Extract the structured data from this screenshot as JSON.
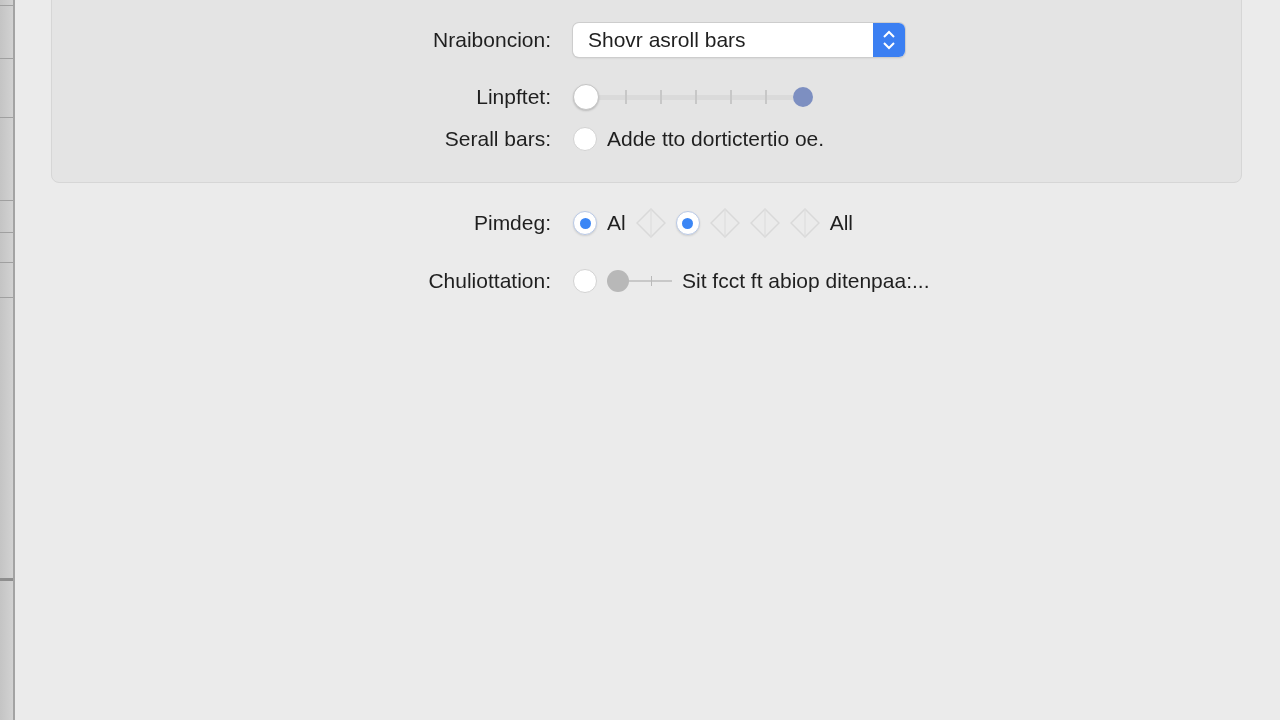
{
  "panel": {
    "rows": [
      {
        "label": "Nraiboncion:",
        "controls": [
          {
            "kind": "popup",
            "value": "Shovr asroll bars"
          }
        ]
      },
      {
        "label": "Linpftet:",
        "controls": [
          {
            "kind": "tick_slider",
            "level": 0
          },
          {
            "kind": "dot"
          }
        ]
      },
      {
        "label": "Serall bars:",
        "controls": [
          {
            "kind": "radio",
            "selected": false
          },
          {
            "kind": "text",
            "text": "Adde tto dortictertio oe."
          }
        ]
      }
    ]
  },
  "rows": [
    {
      "label": "Pimdeg:",
      "controls": [
        {
          "kind": "radio",
          "selected": true
        },
        {
          "kind": "text",
          "text": "Al"
        },
        {
          "kind": "icon"
        },
        {
          "kind": "radio",
          "selected": true
        },
        {
          "kind": "icon"
        },
        {
          "kind": "icon"
        },
        {
          "kind": "icon"
        },
        {
          "kind": "text",
          "text": "All"
        }
      ]
    },
    {
      "label": "Chuliottation:",
      "controls": [
        {
          "kind": "radio",
          "selected": false
        },
        {
          "kind": "small_slider",
          "level": 0
        },
        {
          "kind": "text",
          "text": "Sit fcct ft abiop ditenpaa:..."
        }
      ]
    }
  ]
}
